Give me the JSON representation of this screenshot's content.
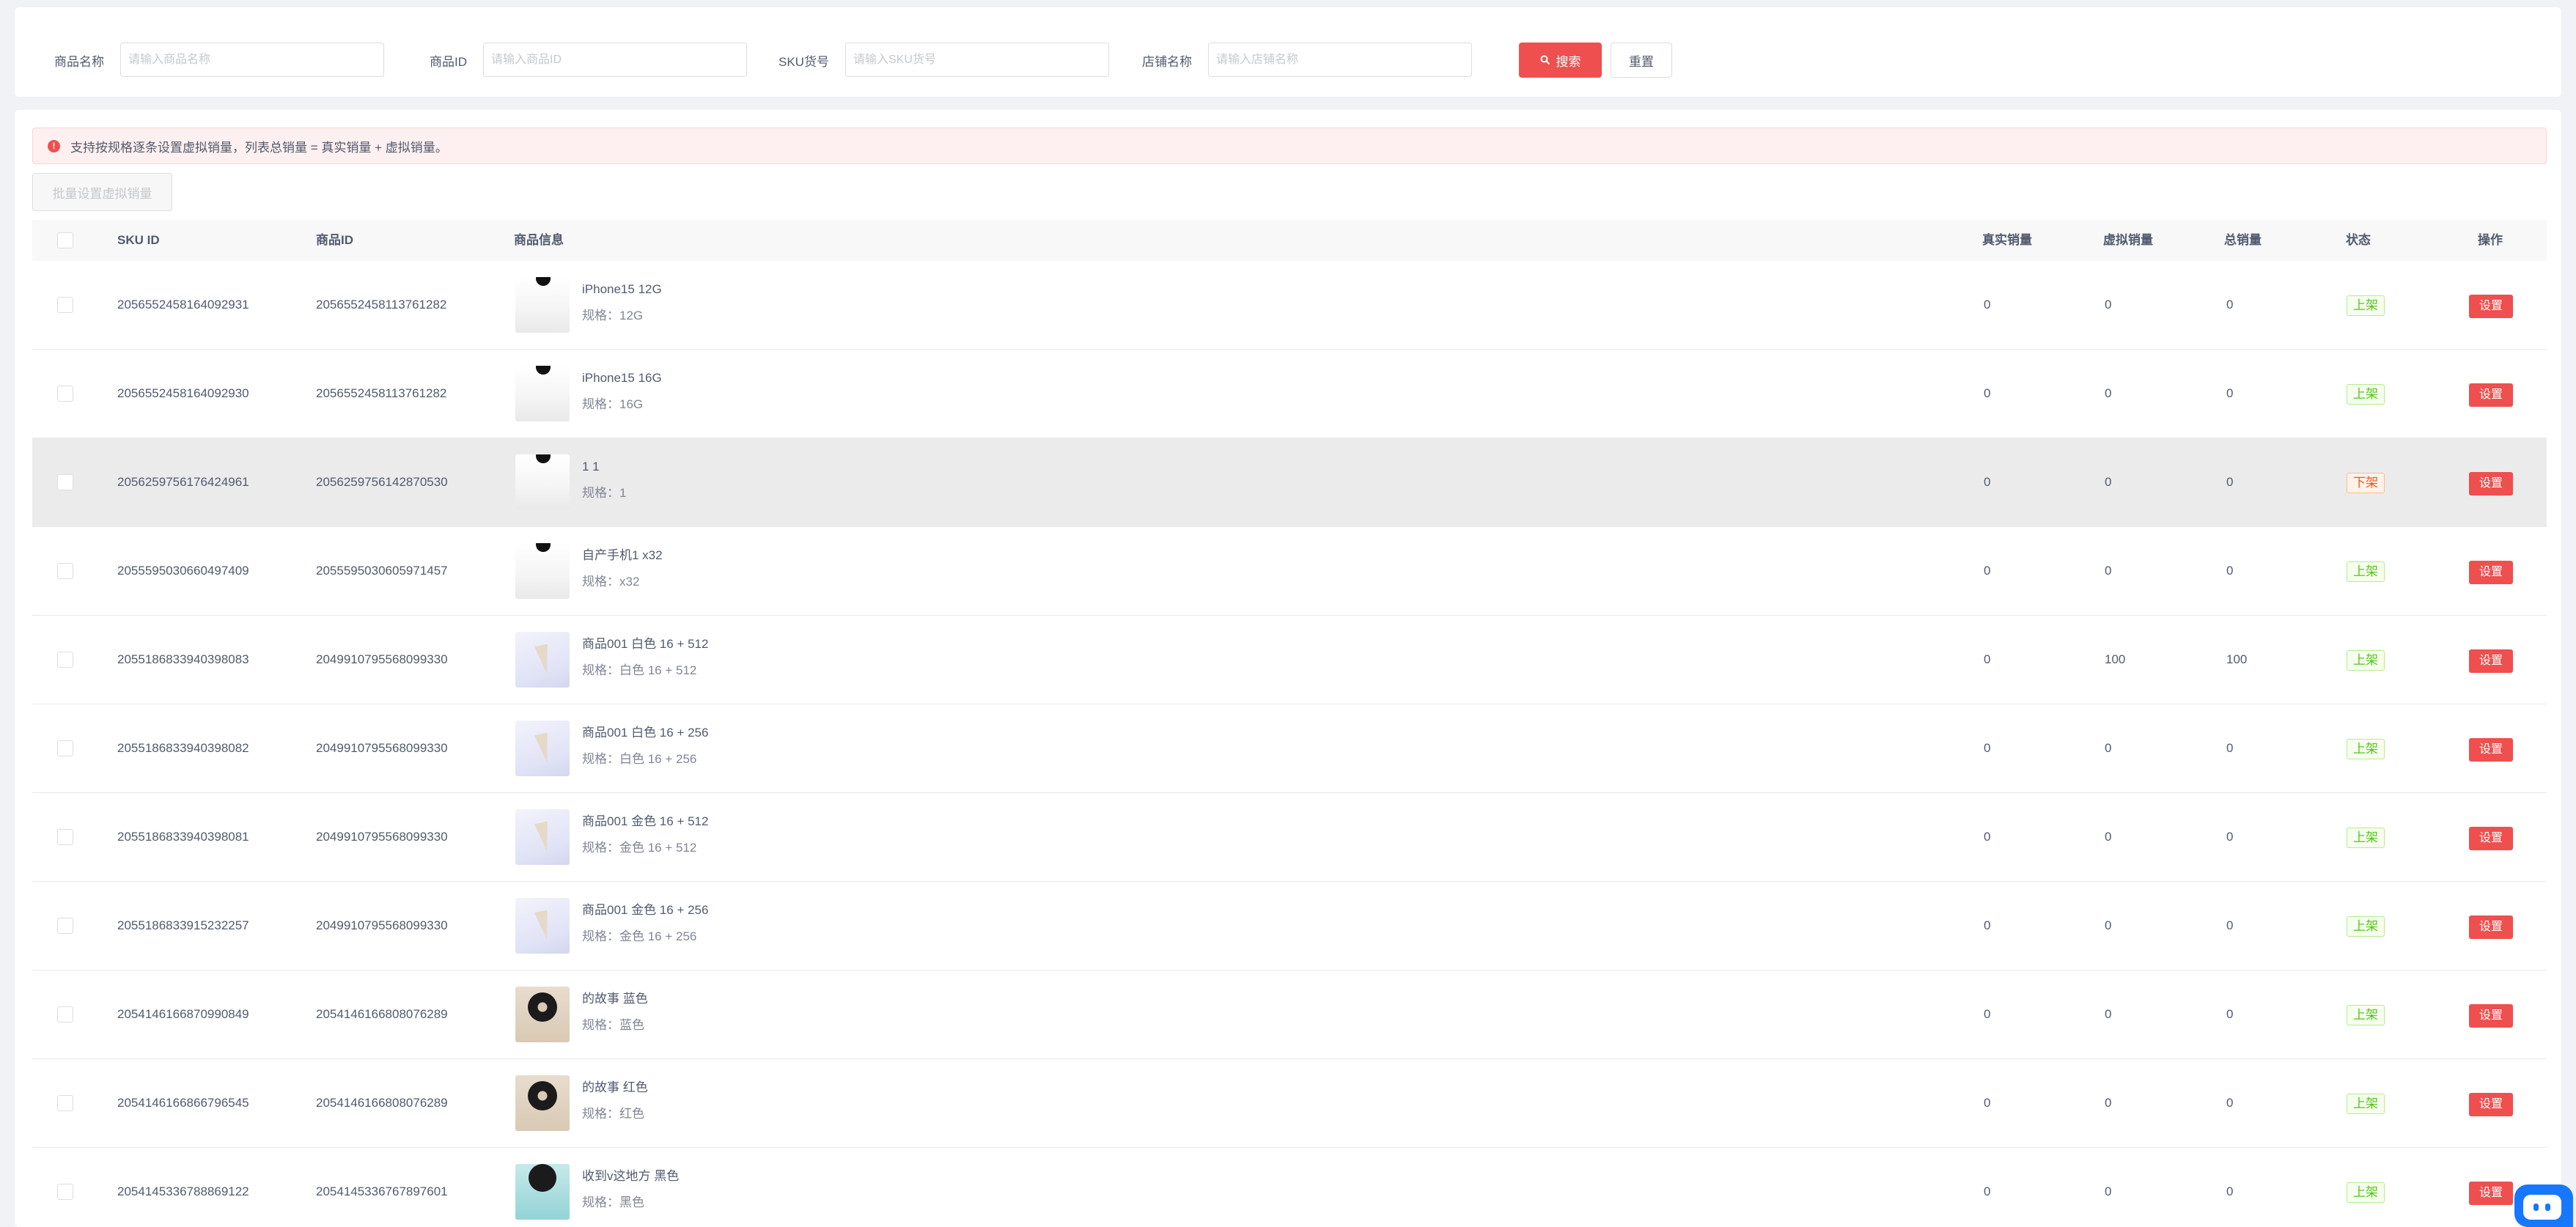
{
  "filters": {
    "product_name_label": "商品名称",
    "product_name_placeholder": "请输入商品名称",
    "product_id_label": "商品ID",
    "product_id_placeholder": "请输入商品ID",
    "sku_code_label": "SKU货号",
    "sku_code_placeholder": "请输入SKU货号",
    "shop_name_label": "店铺名称",
    "shop_name_placeholder": "请输入店铺名称",
    "search_label": "搜索",
    "reset_label": "重置"
  },
  "alert": {
    "text": "支持按规格逐条设置虚拟销量，列表总销量 = 真实销量 + 虚拟销量。"
  },
  "batch_button_label": "批量设置虚拟销量",
  "table": {
    "headers": {
      "sku_id": "SKU ID",
      "product_id": "商品ID",
      "product_info": "商品信息",
      "real_sales": "真实销量",
      "virtual_sales": "虚拟销量",
      "total_sales": "总销量",
      "status": "状态",
      "action": "操作"
    },
    "rows": [
      {
        "sku_id": "2056552458164092931",
        "product_id": "2056552458113761282",
        "name": "iPhone15 12G",
        "spec": "规格：12G",
        "real": "0",
        "virtual": "0",
        "total": "0",
        "status": "上架",
        "action": "设置",
        "image": "phone"
      },
      {
        "sku_id": "2056552458164092930",
        "product_id": "2056552458113761282",
        "name": "iPhone15 16G",
        "spec": "规格：16G",
        "real": "0",
        "virtual": "0",
        "total": "0",
        "status": "上架",
        "action": "设置",
        "image": "phone"
      },
      {
        "sku_id": "2056259756176424961",
        "product_id": "2056259756142870530",
        "name": "1 1",
        "spec": "规格：1",
        "real": "0",
        "virtual": "0",
        "total": "0",
        "status": "下架",
        "action": "设置",
        "image": "phone"
      },
      {
        "sku_id": "2055595030660497409",
        "product_id": "2055595030605971457",
        "name": "自产手机1 x32",
        "spec": "规格：x32",
        "real": "0",
        "virtual": "0",
        "total": "0",
        "status": "上架",
        "action": "设置",
        "image": "phone"
      },
      {
        "sku_id": "2055186833940398083",
        "product_id": "2049910795568099330",
        "name": "商品001 白色 16 + 512",
        "spec": "规格：白色 16 + 512",
        "real": "0",
        "virtual": "100",
        "total": "100",
        "status": "上架",
        "action": "设置",
        "image": "cone"
      },
      {
        "sku_id": "2055186833940398082",
        "product_id": "2049910795568099330",
        "name": "商品001 白色 16 + 256",
        "spec": "规格：白色 16 + 256",
        "real": "0",
        "virtual": "0",
        "total": "0",
        "status": "上架",
        "action": "设置",
        "image": "cone"
      },
      {
        "sku_id": "2055186833940398081",
        "product_id": "2049910795568099330",
        "name": "商品001 金色 16 + 512",
        "spec": "规格：金色 16 + 512",
        "real": "0",
        "virtual": "0",
        "total": "0",
        "status": "上架",
        "action": "设置",
        "image": "cone"
      },
      {
        "sku_id": "2055186833915232257",
        "product_id": "2049910795568099330",
        "name": "商品001 金色 16 + 256",
        "spec": "规格：金色 16 + 256",
        "real": "0",
        "virtual": "0",
        "total": "0",
        "status": "上架",
        "action": "设置",
        "image": "cone"
      },
      {
        "sku_id": "2054146166870990849",
        "product_id": "2054146166808076289",
        "name": "的故事 蓝色",
        "spec": "规格：蓝色",
        "real": "0",
        "virtual": "0",
        "total": "0",
        "status": "上架",
        "action": "设置",
        "image": "disc"
      },
      {
        "sku_id": "2054146166866796545",
        "product_id": "2054146166808076289",
        "name": "的故事 红色",
        "spec": "规格：红色",
        "real": "0",
        "virtual": "0",
        "total": "0",
        "status": "上架",
        "action": "设置",
        "image": "disc"
      },
      {
        "sku_id": "2054145336788869122",
        "product_id": "2054145336767897601",
        "name": "收到v这地方 黑色",
        "spec": "规格：黑色",
        "real": "0",
        "virtual": "0",
        "total": "0",
        "status": "上架",
        "action": "设置",
        "image": "teal"
      }
    ]
  },
  "colors": {
    "primary": "#ef4f4f",
    "on_shelf": "#52c41a",
    "off_shelf": "#fa541c",
    "highlight_row": "#ebebeb"
  }
}
